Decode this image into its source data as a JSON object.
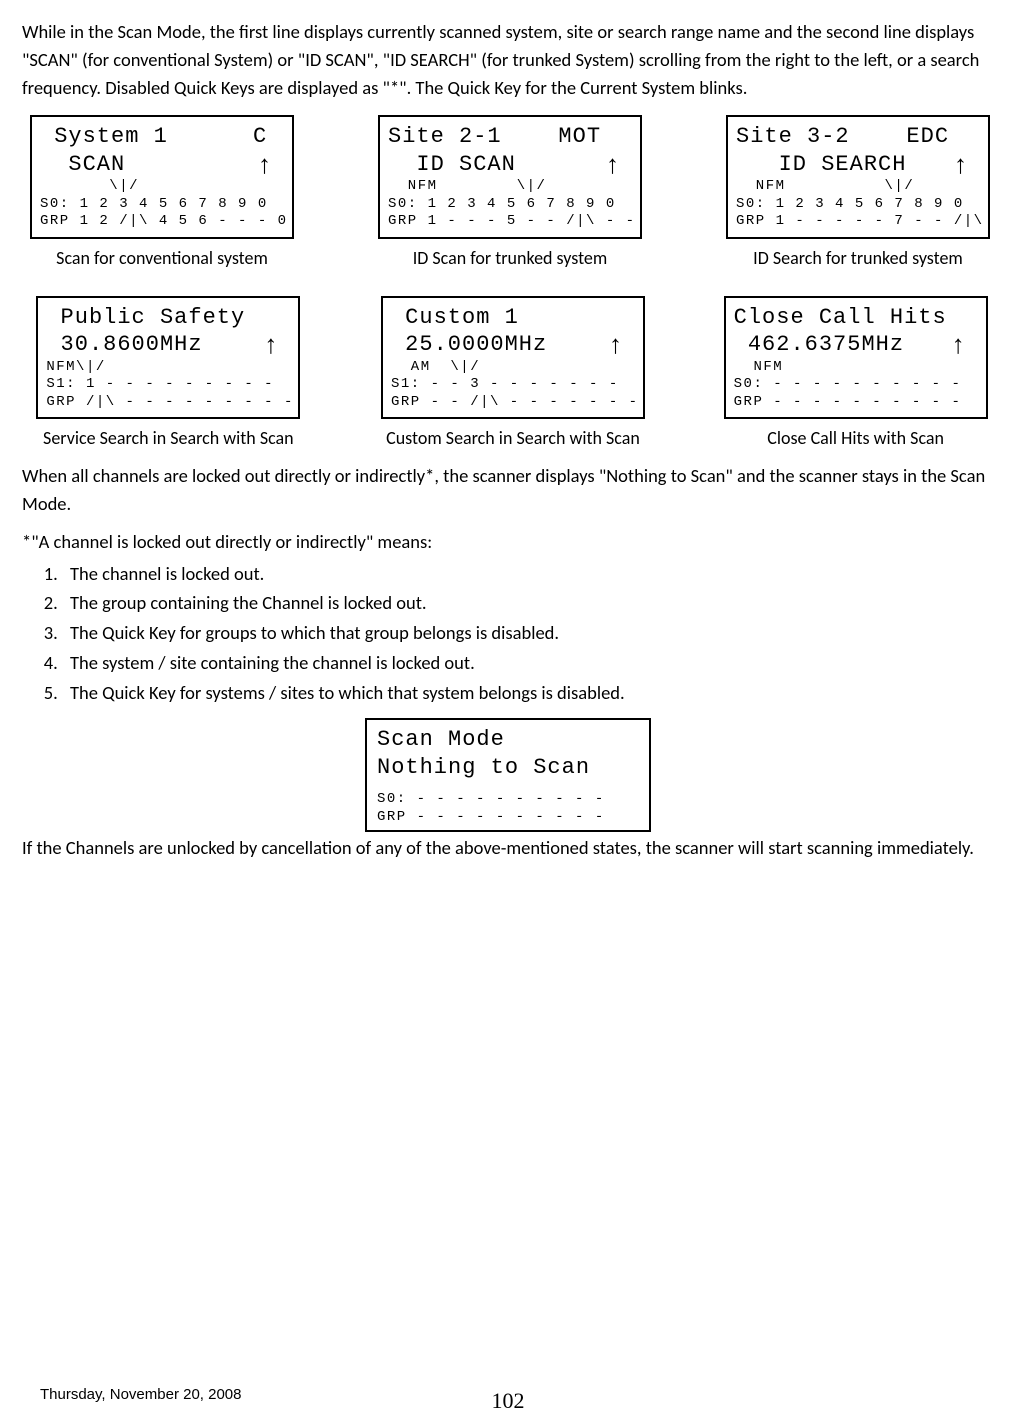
{
  "intro": "While in the Scan Mode, the first line displays currently scanned system, site or search range name and the second line displays \"SCAN\" (for conventional System) or \"ID SCAN\", \"ID SEARCH\" (for trunked System) scrolling from the right to the left, or a search frequency. Disabled Quick Keys are displayed as \"*\". The Quick Key for the Current System blinks.",
  "lcds_row1": [
    {
      "l1": " System 1      C",
      "l2": "  SCAN",
      "arrow": "↑",
      "l3": "       \\|/",
      "l4": "S0: 1 2 3 4 5 6 7 8 9 0",
      "l5": "GRP 1 2 /|\\ 4 5 6 - - - 0",
      "caption": "Scan for conventional system"
    },
    {
      "l1": "Site 2-1    MOT",
      "l2": "  ID SCAN",
      "arrow": "↑",
      "l3": "  NFM        \\|/",
      "l4": "S0: 1 2 3 4 5 6 7 8 9 0",
      "l5": "GRP 1 - - - 5 - - /|\\ - -",
      "caption": "ID Scan for trunked system"
    },
    {
      "l1": "Site 3-2    EDC",
      "l2": "   ID SEARCH",
      "arrow": "↑",
      "l3": "  NFM          \\|/",
      "l4": "S0: 1 2 3 4 5 6 7 8 9 0",
      "l5": "GRP 1 - - - - - 7 - - /|\\",
      "caption": "ID Search for trunked system"
    }
  ],
  "lcds_row2": [
    {
      "l1": " Public Safety",
      "l2": " 30.8600MHz",
      "arrow": "↑",
      "l3": "NFM\\|/",
      "l4": "S1: 1 - - - - - - - - -",
      "l5": "GRP /|\\ - - - - - - - - -",
      "caption": "Service Search in Search with Scan"
    },
    {
      "l1": " Custom 1",
      "l2": " 25.0000MHz",
      "arrow": "↑",
      "l3": "  AM  \\|/",
      "l4": "S1: - - 3 - - - - - - -",
      "l5": "GRP - - /|\\ - - - - - - -",
      "caption": "Custom Search in Search with Scan"
    },
    {
      "l1": "Close Call Hits",
      "l2": " 462.6375MHz",
      "arrow": "↑",
      "l3": "  NFM",
      "l4": "S0: - - - - - - - - - -",
      "l5": "GRP - - - - - - - - - -",
      "caption": "Close Call Hits with Scan"
    }
  ],
  "locked_para": "When all channels are locked out directly or indirectly*, the scanner displays \"Nothing to Scan\" and the scanner stays in the Scan Mode.",
  "means_heading": "*\"A channel is locked out directly or indirectly\" means:",
  "means": [
    "The channel is locked out.",
    "The group containing the Channel is locked out.",
    "The Quick Key for groups to which that group belongs is disabled.",
    "The system / site containing the channel is locked out.",
    "The Quick Key for systems / sites to which that system belongs is disabled."
  ],
  "nothing_lcd": {
    "l1": "Scan Mode",
    "l2": "Nothing to Scan",
    "l3": "S0: - - - - - - - - - -",
    "l4": "GRP - - - - - - - - - -"
  },
  "unlock_para": "If the Channels are unlocked by cancellation of any of the above-mentioned states, the scanner will start scanning immediately.",
  "footer": {
    "date": "Thursday, November 20, 2008",
    "page": "102"
  }
}
